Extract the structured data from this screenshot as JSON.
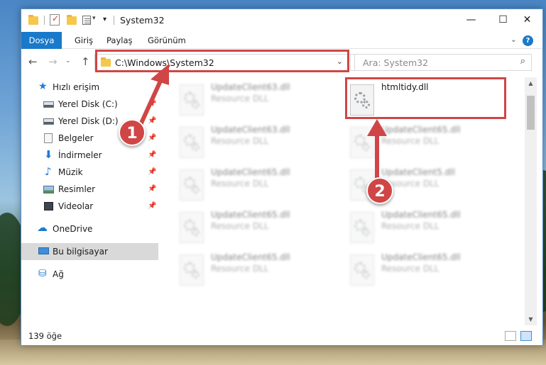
{
  "window": {
    "title": "System32",
    "controls": {
      "minimize": "—",
      "maximize": "☐",
      "close": "✕"
    }
  },
  "quick_access_toolbar": {
    "dropdown": "▾"
  },
  "ribbon": {
    "tabs": [
      {
        "label": "Dosya",
        "active": true
      },
      {
        "label": "Giriş"
      },
      {
        "label": "Paylaş"
      },
      {
        "label": "Görünüm"
      }
    ],
    "expand_chevron": "⌄",
    "help": "?"
  },
  "navigation": {
    "back": "←",
    "forward": "→",
    "recent": "⌄",
    "up": "↑",
    "address": "C:\\Windows\\System32",
    "address_dropdown": "⌄",
    "refresh": "↻",
    "search_placeholder": "Ara: System32",
    "search_icon": "⌕"
  },
  "sidebar": {
    "items": [
      {
        "label": "Hızlı erişim",
        "icon": "star-icon",
        "glyph": "★"
      },
      {
        "label": "Yerel Disk (C:)",
        "icon": "disk-icon",
        "pinned": true
      },
      {
        "label": "Yerel Disk (D:)",
        "icon": "disk-icon",
        "pinned": true
      },
      {
        "label": "Belgeler",
        "icon": "documents-icon",
        "pinned": true
      },
      {
        "label": "İndirmeler",
        "icon": "download-icon",
        "glyph": "⬇",
        "pinned": true
      },
      {
        "label": "Müzik",
        "icon": "music-icon",
        "glyph": "♪",
        "pinned": true
      },
      {
        "label": "Resimler",
        "icon": "pictures-icon",
        "pinned": true
      },
      {
        "label": "Videolar",
        "icon": "videos-icon",
        "pinned": true
      },
      {
        "label": "OneDrive",
        "icon": "onedrive-icon",
        "glyph": "☁"
      },
      {
        "label": "Bu bilgisayar",
        "icon": "computer-icon",
        "selected": true
      },
      {
        "label": "Ağ",
        "icon": "network-icon",
        "glyph": "⛁"
      }
    ],
    "pin_glyph": "📌"
  },
  "files": [
    {
      "name": "UpdateClient63.dll",
      "type": "Resource DLL",
      "blurred": true
    },
    {
      "name": "htmltidy.dll",
      "type": "",
      "blurred": false,
      "highlighted": true
    },
    {
      "name": "UpdateClient63.dll",
      "type": "Resource DLL",
      "blurred": true
    },
    {
      "name": "UpdateClient65.dll",
      "type": "Resource DLL",
      "blurred": true
    },
    {
      "name": "UpdateClient65.dll",
      "type": "Resource DLL",
      "blurred": true
    },
    {
      "name": "UpdateClient5.dll",
      "type": "Resource DLL",
      "blurred": true
    },
    {
      "name": "UpdateClient65.dll",
      "type": "Resource DLL",
      "blurred": true
    },
    {
      "name": "UpdateClient65.dll",
      "type": "Resource DLL",
      "blurred": true
    },
    {
      "name": "UpdateClient65.dll",
      "type": "Resource DLL",
      "blurred": true
    },
    {
      "name": "UpdateClient65.dll",
      "type": "Resource DLL",
      "blurred": true
    }
  ],
  "status": {
    "item_count": "139 öğe"
  },
  "scrollbar": {
    "up": "▲",
    "down": "▼"
  },
  "annotations": {
    "callout_1": "1",
    "callout_2": "2",
    "color": "#d04545"
  },
  "colors": {
    "accent": "#1979ca",
    "highlight": "#d04545",
    "selected_bg": "#d9d9d9"
  }
}
